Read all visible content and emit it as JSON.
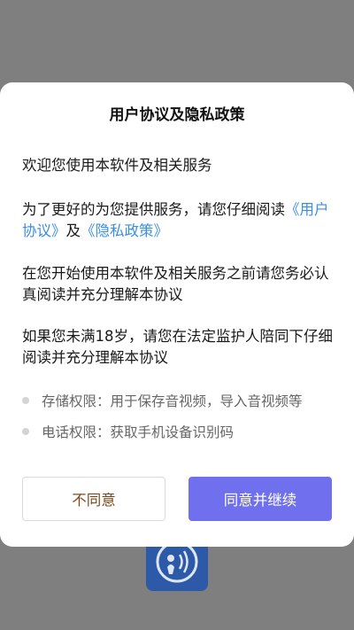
{
  "dialog": {
    "title": "用户协议及隐私政策",
    "intro": "欢迎您使用本软件及相关服务",
    "read_prefix": "为了更好的为您提供服务，请您仔细阅读",
    "user_agreement_link": "《用户协议》",
    "and_text": "及",
    "privacy_policy_link": "《隐私政策》",
    "before_use_text": "在您开始使用本软件及相关服务之前请您务必认真阅读并充分理解本协议",
    "minor_text": "如果您未满18岁，请您在法定监护人陪同下仔细阅读并充分理解本协议",
    "permissions": [
      "存储权限：用于保存音视频，导入音视频等",
      "电话权限：获取手机设备识别码"
    ],
    "decline_label": "不同意",
    "accept_label": "同意并继续"
  },
  "colors": {
    "accent": "#7070ee",
    "link": "#3a8ee6",
    "decline_text": "#7a4a1c",
    "backdrop": "#7f7f7f",
    "app_icon_bg": "#2c5aa8"
  },
  "icons": {
    "app_icon": "voice-recorder-icon"
  }
}
